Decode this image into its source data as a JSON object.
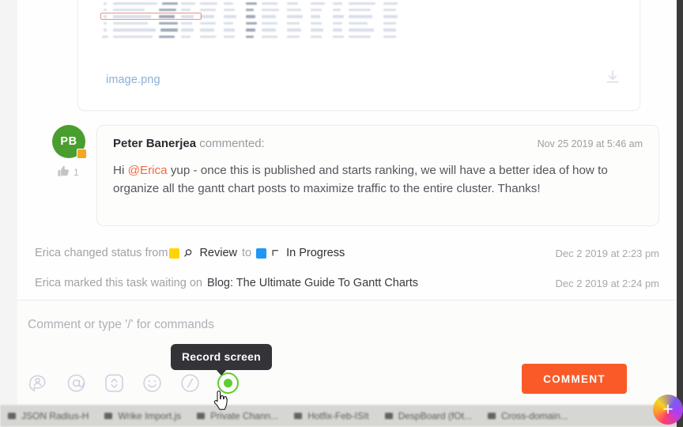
{
  "attachment": {
    "filename": "image.png",
    "download_icon": "download-icon"
  },
  "comment": {
    "avatar_initials": "PB",
    "author": "Peter Banerjea",
    "action_text": "commented:",
    "timestamp": "Nov 25 2019 at 5:46 am",
    "reaction_count": "1",
    "reaction_icon": "thumbs-up-icon",
    "body_prefix": "Hi ",
    "mention": "@Erica",
    "body_rest": " yup - once this is published and starts ranking, we will have a better idea of how to organize all the gantt chart posts to maximize traffic to the entire cluster. Thanks!"
  },
  "activity": [
    {
      "actor_text": "Erica changed status from",
      "from_status": "Review",
      "from_color": "#ffd400",
      "from_icon": "magnifier-icon",
      "middle_text": "to",
      "to_status": "In Progress",
      "to_color": "#2196f3",
      "to_icon": "arrow-up-left-icon",
      "time": "Dec 2 2019 at 2:23 pm"
    },
    {
      "actor_text": "Erica marked this task waiting on",
      "target": "Blog: The Ultimate Guide To Gantt Charts",
      "time": "Dec 2 2019 at 2:24 pm"
    }
  ],
  "composer": {
    "placeholder": "Comment or type '/' for commands",
    "tooltip": "Record screen",
    "submit_label": "COMMENT",
    "submit_color": "#fa5a28",
    "record_color": "#5ecd2e",
    "tools": [
      {
        "name": "assign-comment-icon"
      },
      {
        "name": "mention-icon"
      },
      {
        "name": "expand-collapse-icon"
      },
      {
        "name": "emoji-icon"
      },
      {
        "name": "slash-command-icon"
      },
      {
        "name": "record-screen-icon"
      }
    ],
    "attach_icon": "paperclip-icon"
  },
  "fab": {
    "icon": "plus-icon"
  },
  "taskbar": {
    "items": [
      "JSON Radius-H",
      "Wrike Import.js",
      "Private Chann...",
      "Hotfix-Feb-ISIt",
      "DespBoard (fOt...",
      "Cross-domain..."
    ]
  }
}
